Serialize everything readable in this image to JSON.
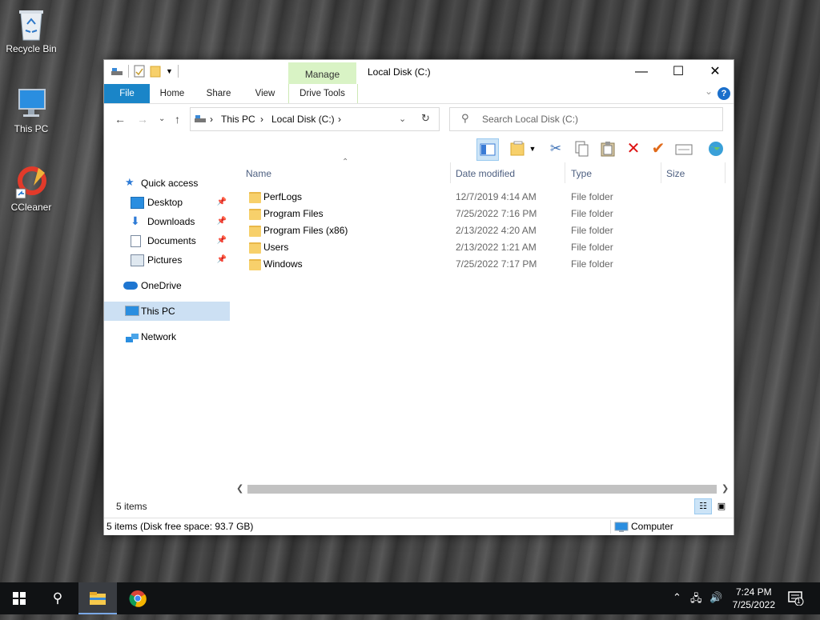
{
  "desktop": {
    "icons": [
      {
        "label": "Recycle Bin"
      },
      {
        "label": "This PC"
      },
      {
        "label": "CCleaner"
      }
    ]
  },
  "window": {
    "title": "Local Disk (C:)",
    "contextual_tab": "Manage",
    "contextual_group": "Drive Tools",
    "tabs": [
      "File",
      "Home",
      "Share",
      "View"
    ],
    "controls": {
      "minimize": "—",
      "maximize": "☐",
      "close": "✕"
    }
  },
  "address": {
    "crumbs": [
      "This PC",
      "Local Disk (C:)"
    ],
    "search_placeholder": "Search Local Disk (C:)"
  },
  "nav": {
    "items": [
      {
        "label": "Quick access",
        "icon": "star-icon"
      },
      {
        "label": "Desktop",
        "icon": "desktop-folder-icon",
        "pinned": true
      },
      {
        "label": "Downloads",
        "icon": "download-icon",
        "pinned": true
      },
      {
        "label": "Documents",
        "icon": "documents-icon",
        "pinned": true
      },
      {
        "label": "Pictures",
        "icon": "pictures-icon",
        "pinned": true
      },
      {
        "label": "OneDrive",
        "icon": "cloud-icon"
      },
      {
        "label": "This PC",
        "icon": "computer-icon",
        "selected": true
      },
      {
        "label": "Network",
        "icon": "network-icon"
      }
    ]
  },
  "files": {
    "columns": [
      "Name",
      "Date modified",
      "Type",
      "Size"
    ],
    "rows": [
      {
        "name": "PerfLogs",
        "date": "12/7/2019 4:14 AM",
        "type": "File folder"
      },
      {
        "name": "Program Files",
        "date": "7/25/2022 7:16 PM",
        "type": "File folder"
      },
      {
        "name": "Program Files (x86)",
        "date": "2/13/2022 4:20 AM",
        "type": "File folder"
      },
      {
        "name": "Users",
        "date": "2/13/2022 1:21 AM",
        "type": "File folder"
      },
      {
        "name": "Windows",
        "date": "7/25/2022 7:17 PM",
        "type": "File folder"
      }
    ]
  },
  "status": {
    "count": "5 items",
    "detail": "5 items (Disk free space: 93.7 GB)",
    "location": "Computer"
  },
  "taskbar": {
    "time": "7:24 PM",
    "date": "7/25/2022",
    "notification_count": "1"
  },
  "colors": {
    "accent": "#1a85c8",
    "manage_tab": "#d9f3c5",
    "selection": "#cce0f3",
    "folder": "#f7d06b"
  }
}
